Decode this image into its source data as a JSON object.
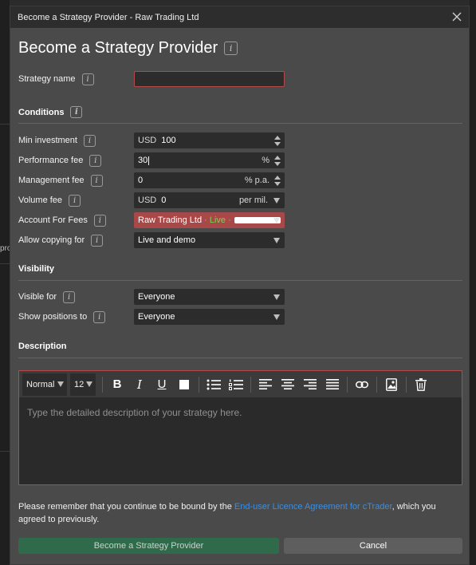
{
  "dialog": {
    "window_title": "Become a Strategy Provider - Raw Trading Ltd",
    "heading": "Become a Strategy Provider"
  },
  "background": {
    "fragment": "pro"
  },
  "info_glyph": "i",
  "form": {
    "strategy_name": {
      "label": "Strategy name",
      "value": ""
    },
    "conditions_title": "Conditions",
    "min_investment": {
      "label": "Min investment",
      "currency": "USD",
      "value": "100"
    },
    "performance_fee": {
      "label": "Performance fee",
      "value": "30",
      "suffix": "%"
    },
    "management_fee": {
      "label": "Management fee",
      "value": "0",
      "suffix": "% p.a."
    },
    "volume_fee": {
      "label": "Volume fee",
      "currency": "USD",
      "value": "0",
      "suffix": "per mil."
    },
    "account_for_fees": {
      "label": "Account For Fees",
      "broker": "Raw Trading Ltd",
      "sep": "·",
      "account_type": "Live ·"
    },
    "allow_copying": {
      "label": "Allow copying for",
      "value": "Live and demo"
    },
    "visibility_title": "Visibility",
    "visible_for": {
      "label": "Visible for",
      "value": "Everyone"
    },
    "show_positions": {
      "label": "Show positions to",
      "value": "Everyone"
    },
    "description_title": "Description"
  },
  "editor": {
    "font_style": "Normal",
    "font_size": "12",
    "bold_glyph": "B",
    "italic_glyph": "I",
    "underline_glyph": "U",
    "placeholder": "Type the detailed description of your strategy here."
  },
  "notice": {
    "before": "Please remember that you continue to be bound by the ",
    "link": "End-user Licence Agreement for cTrader",
    "after": ", which you agreed to previously."
  },
  "buttons": {
    "submit": "Become a Strategy Provider",
    "cancel": "Cancel"
  },
  "colors": {
    "dialog_bg": "#4a4a4a",
    "titlebar_bg": "#2d2d2d",
    "error_border": "#b24a4a",
    "account_bg": "#a94848",
    "live_green": "#7ccf52",
    "link_blue": "#3b8fe0",
    "primary_green": "#2f6b4b"
  }
}
